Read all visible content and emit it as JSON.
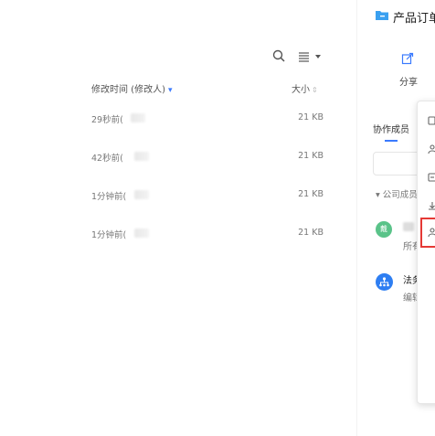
{
  "toolbar": {
    "search_icon": "search-icon",
    "view_icon": "list-view-icon"
  },
  "columns": {
    "modified": "修改时间 (修改人)",
    "size": "大小"
  },
  "rows": [
    {
      "time": "29秒前(",
      "size": "21 KB"
    },
    {
      "time": "42秒前(",
      "size": "21 KB"
    },
    {
      "time": "1分钟前(",
      "size": "21 KB"
    },
    {
      "time": "1分钟前(",
      "size": "21 KB"
    }
  ],
  "panel": {
    "title": "产品订单",
    "share_label": "分享",
    "tab_members": "协作成员",
    "company_section": "▾ 公司成员",
    "user_avatar": "戴",
    "user_perm": "所有",
    "org_name": "法务",
    "org_perm": "编辑"
  },
  "colors": {
    "accent": "#3a7afe",
    "highlight": "#e53935",
    "avatar_green": "#5ac389",
    "avatar_blue": "#2e7ef2"
  }
}
